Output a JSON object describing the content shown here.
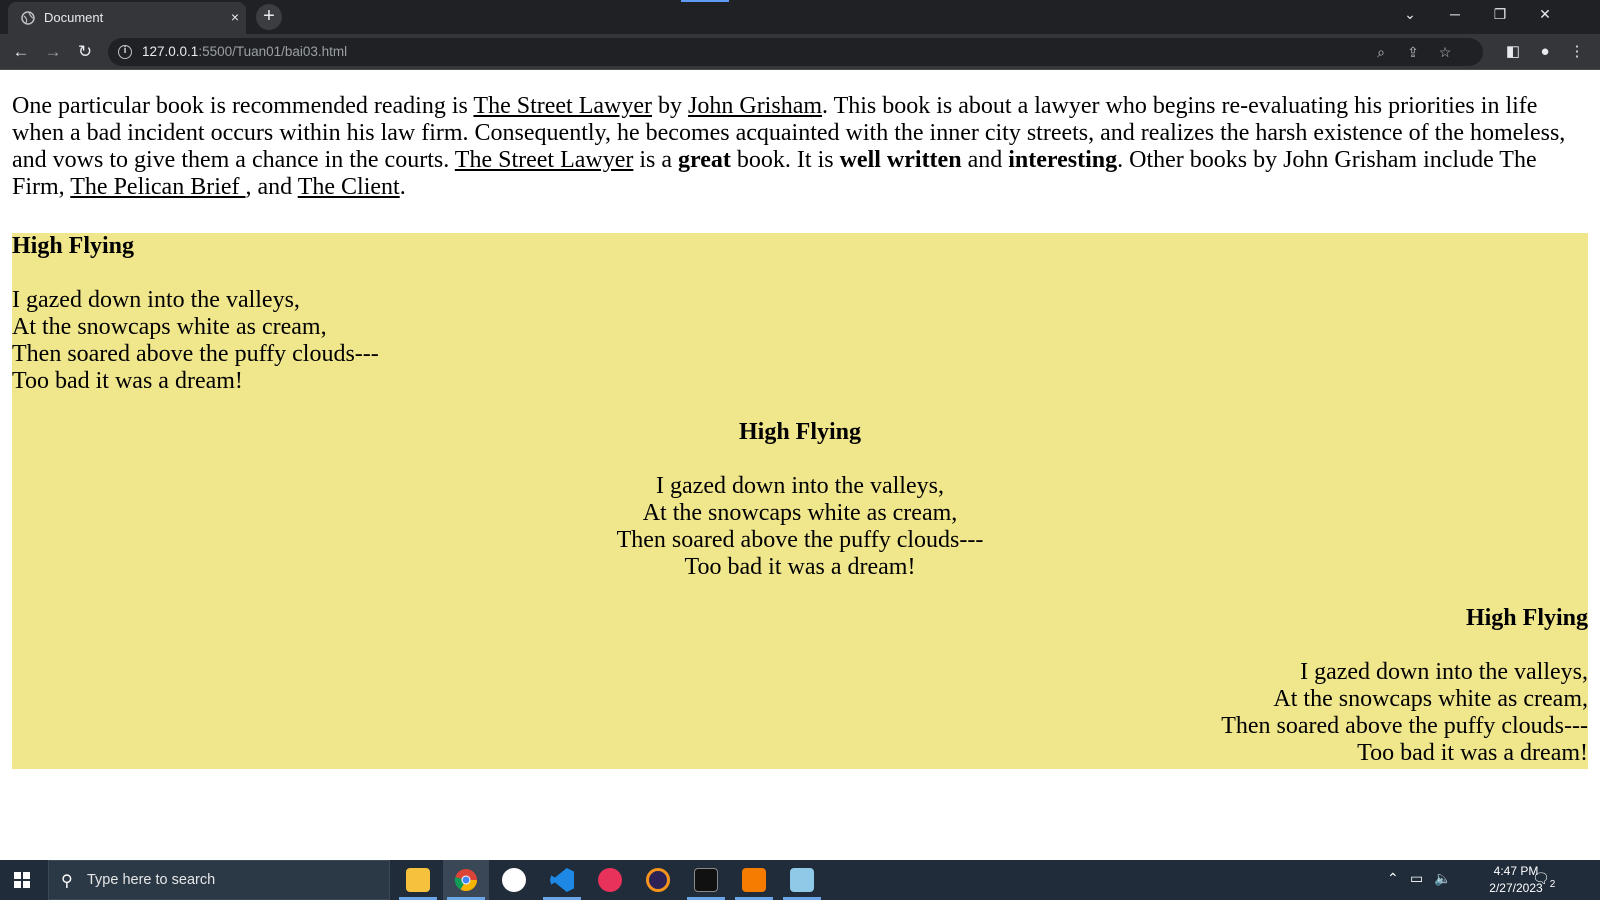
{
  "browser": {
    "tab_title": "Document",
    "tab_close": "×",
    "new_tab": "+",
    "url_host": "127.0.0.1",
    "url_rest": ":5500/Tuan01/bai03.html",
    "info_symbol": "i"
  },
  "content": {
    "paragraph": {
      "t1": "One particular book is recommended reading is ",
      "link1": "The Street Lawyer",
      "t2": " by ",
      "link2": "John Grisham",
      "t3": ". This book is about a lawyer who begins re-evaluating his priorities in life when a bad incident occurs within his law firm. Consequently, he becomes acquainted with the inner city streets, and realizes the harsh existence of the homeless, and vows to give them a chance in the courts. ",
      "link3": "The Street Lawyer",
      "t4": " is a ",
      "b1": "great",
      "t5": " book. It is ",
      "b2": "well written",
      "t6": " and ",
      "b3": "interesting",
      "t7": ". Other books by John Grisham include The Firm, ",
      "link4": "The Pelican Brief ",
      "t8": ", and ",
      "link5": "The Client",
      "t9": "."
    },
    "poem": {
      "title": "High Flying",
      "lines": [
        "I gazed down into the valleys,",
        "At the snowcaps white as cream,",
        "Then soared above the puffy clouds---",
        "Too bad it was a dream!"
      ]
    },
    "poem_bg": "#f0e68c"
  },
  "taskbar": {
    "search_placeholder": "Type here to search",
    "time": "4:47 PM",
    "date": "2/27/2023",
    "notifications": "2",
    "apps": [
      "file-explorer",
      "chrome",
      "app-w",
      "vscode",
      "app-oo",
      "eclipse",
      "terminal",
      "pdf",
      "notepad"
    ]
  }
}
